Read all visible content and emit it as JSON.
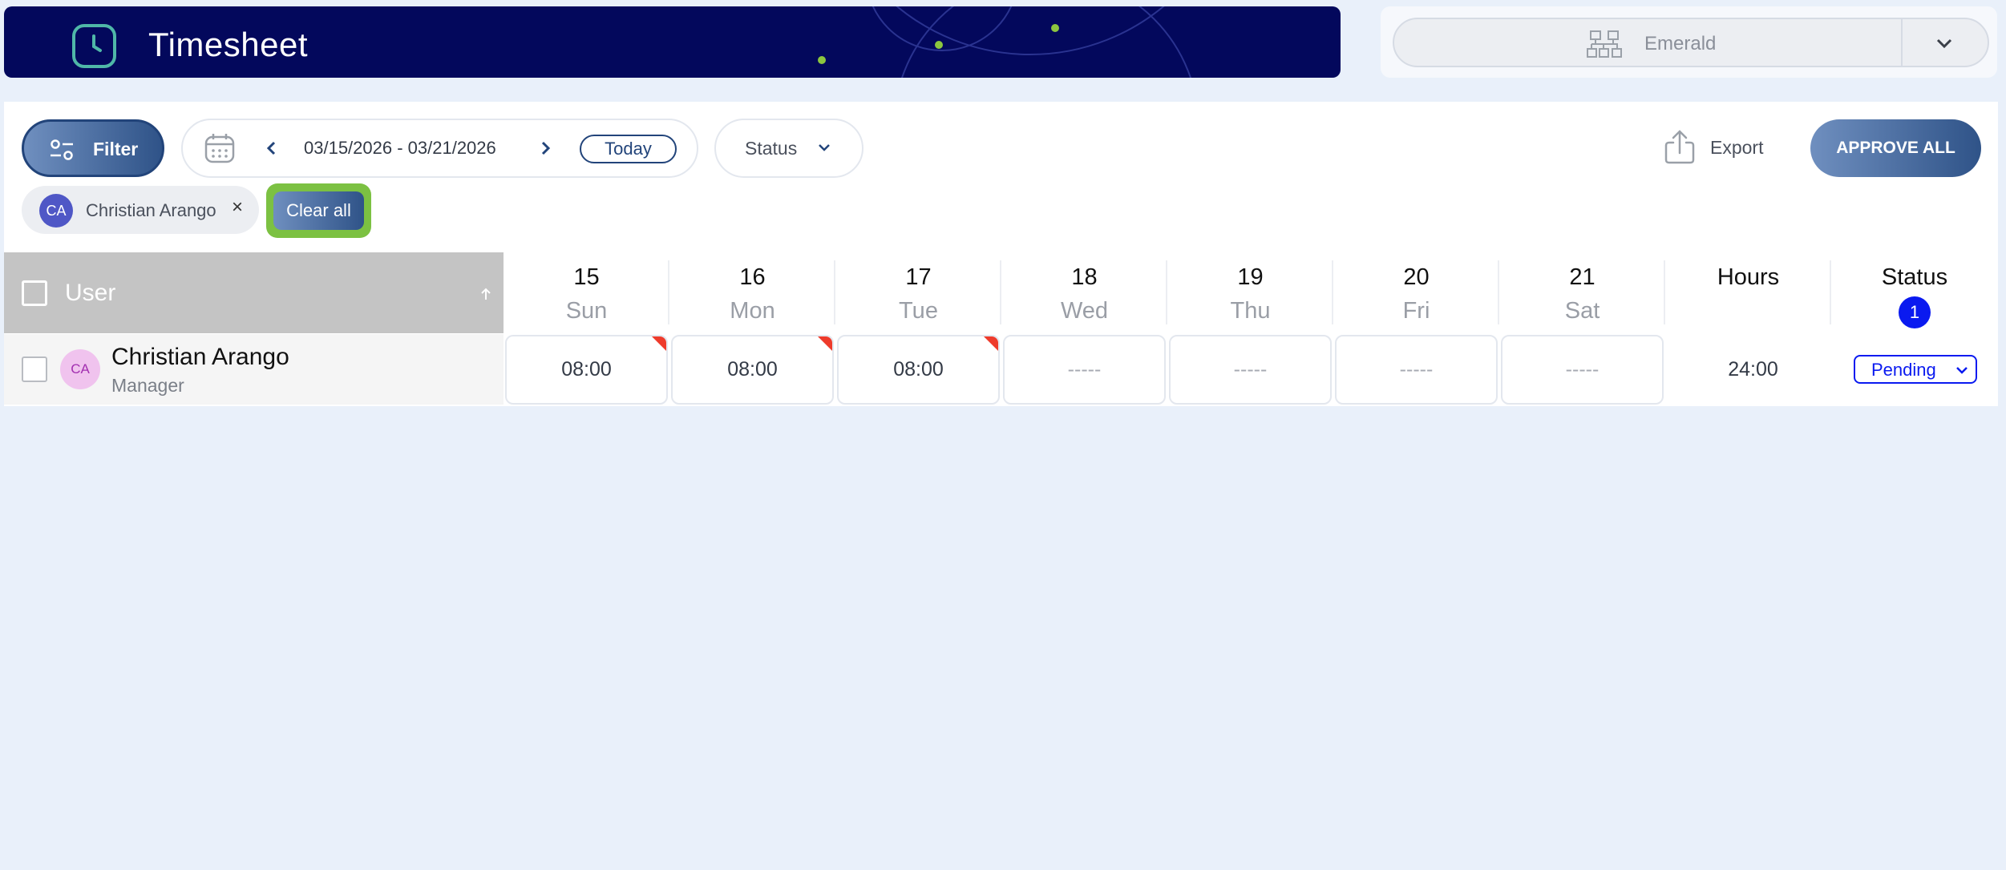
{
  "header": {
    "title": "Timesheet",
    "brand_color": "#03085c",
    "accent_color": "#8cc63f"
  },
  "company_selector": {
    "selected": "Emerald"
  },
  "toolbar": {
    "filter_label": "Filter",
    "date_range": "03/15/2026 - 03/21/2026",
    "today_label": "Today",
    "status_label": "Status",
    "export_label": "Export",
    "approve_all_label": "APPROVE ALL"
  },
  "active_filters": {
    "chip": {
      "initials": "CA",
      "label": "Christian Arango",
      "remove_glyph": "×"
    },
    "clear_all_label": "Clear all"
  },
  "table": {
    "user_header": "User",
    "days": [
      {
        "num": "15",
        "dow": "Sun"
      },
      {
        "num": "16",
        "dow": "Mon"
      },
      {
        "num": "17",
        "dow": "Tue"
      },
      {
        "num": "18",
        "dow": "Wed"
      },
      {
        "num": "19",
        "dow": "Thu"
      },
      {
        "num": "20",
        "dow": "Fri"
      },
      {
        "num": "21",
        "dow": "Sat"
      }
    ],
    "hours_header": "Hours",
    "status_header": "Status",
    "status_badge": "1",
    "rows": [
      {
        "initials": "CA",
        "name": "Christian Arango",
        "role": "Manager",
        "cells": [
          "08:00",
          "08:00",
          "08:00",
          "-----",
          "-----",
          "-----",
          "-----"
        ],
        "flagged": [
          true,
          true,
          true,
          false,
          false,
          false,
          false
        ],
        "total": "24:00",
        "status": "Pending"
      }
    ]
  }
}
